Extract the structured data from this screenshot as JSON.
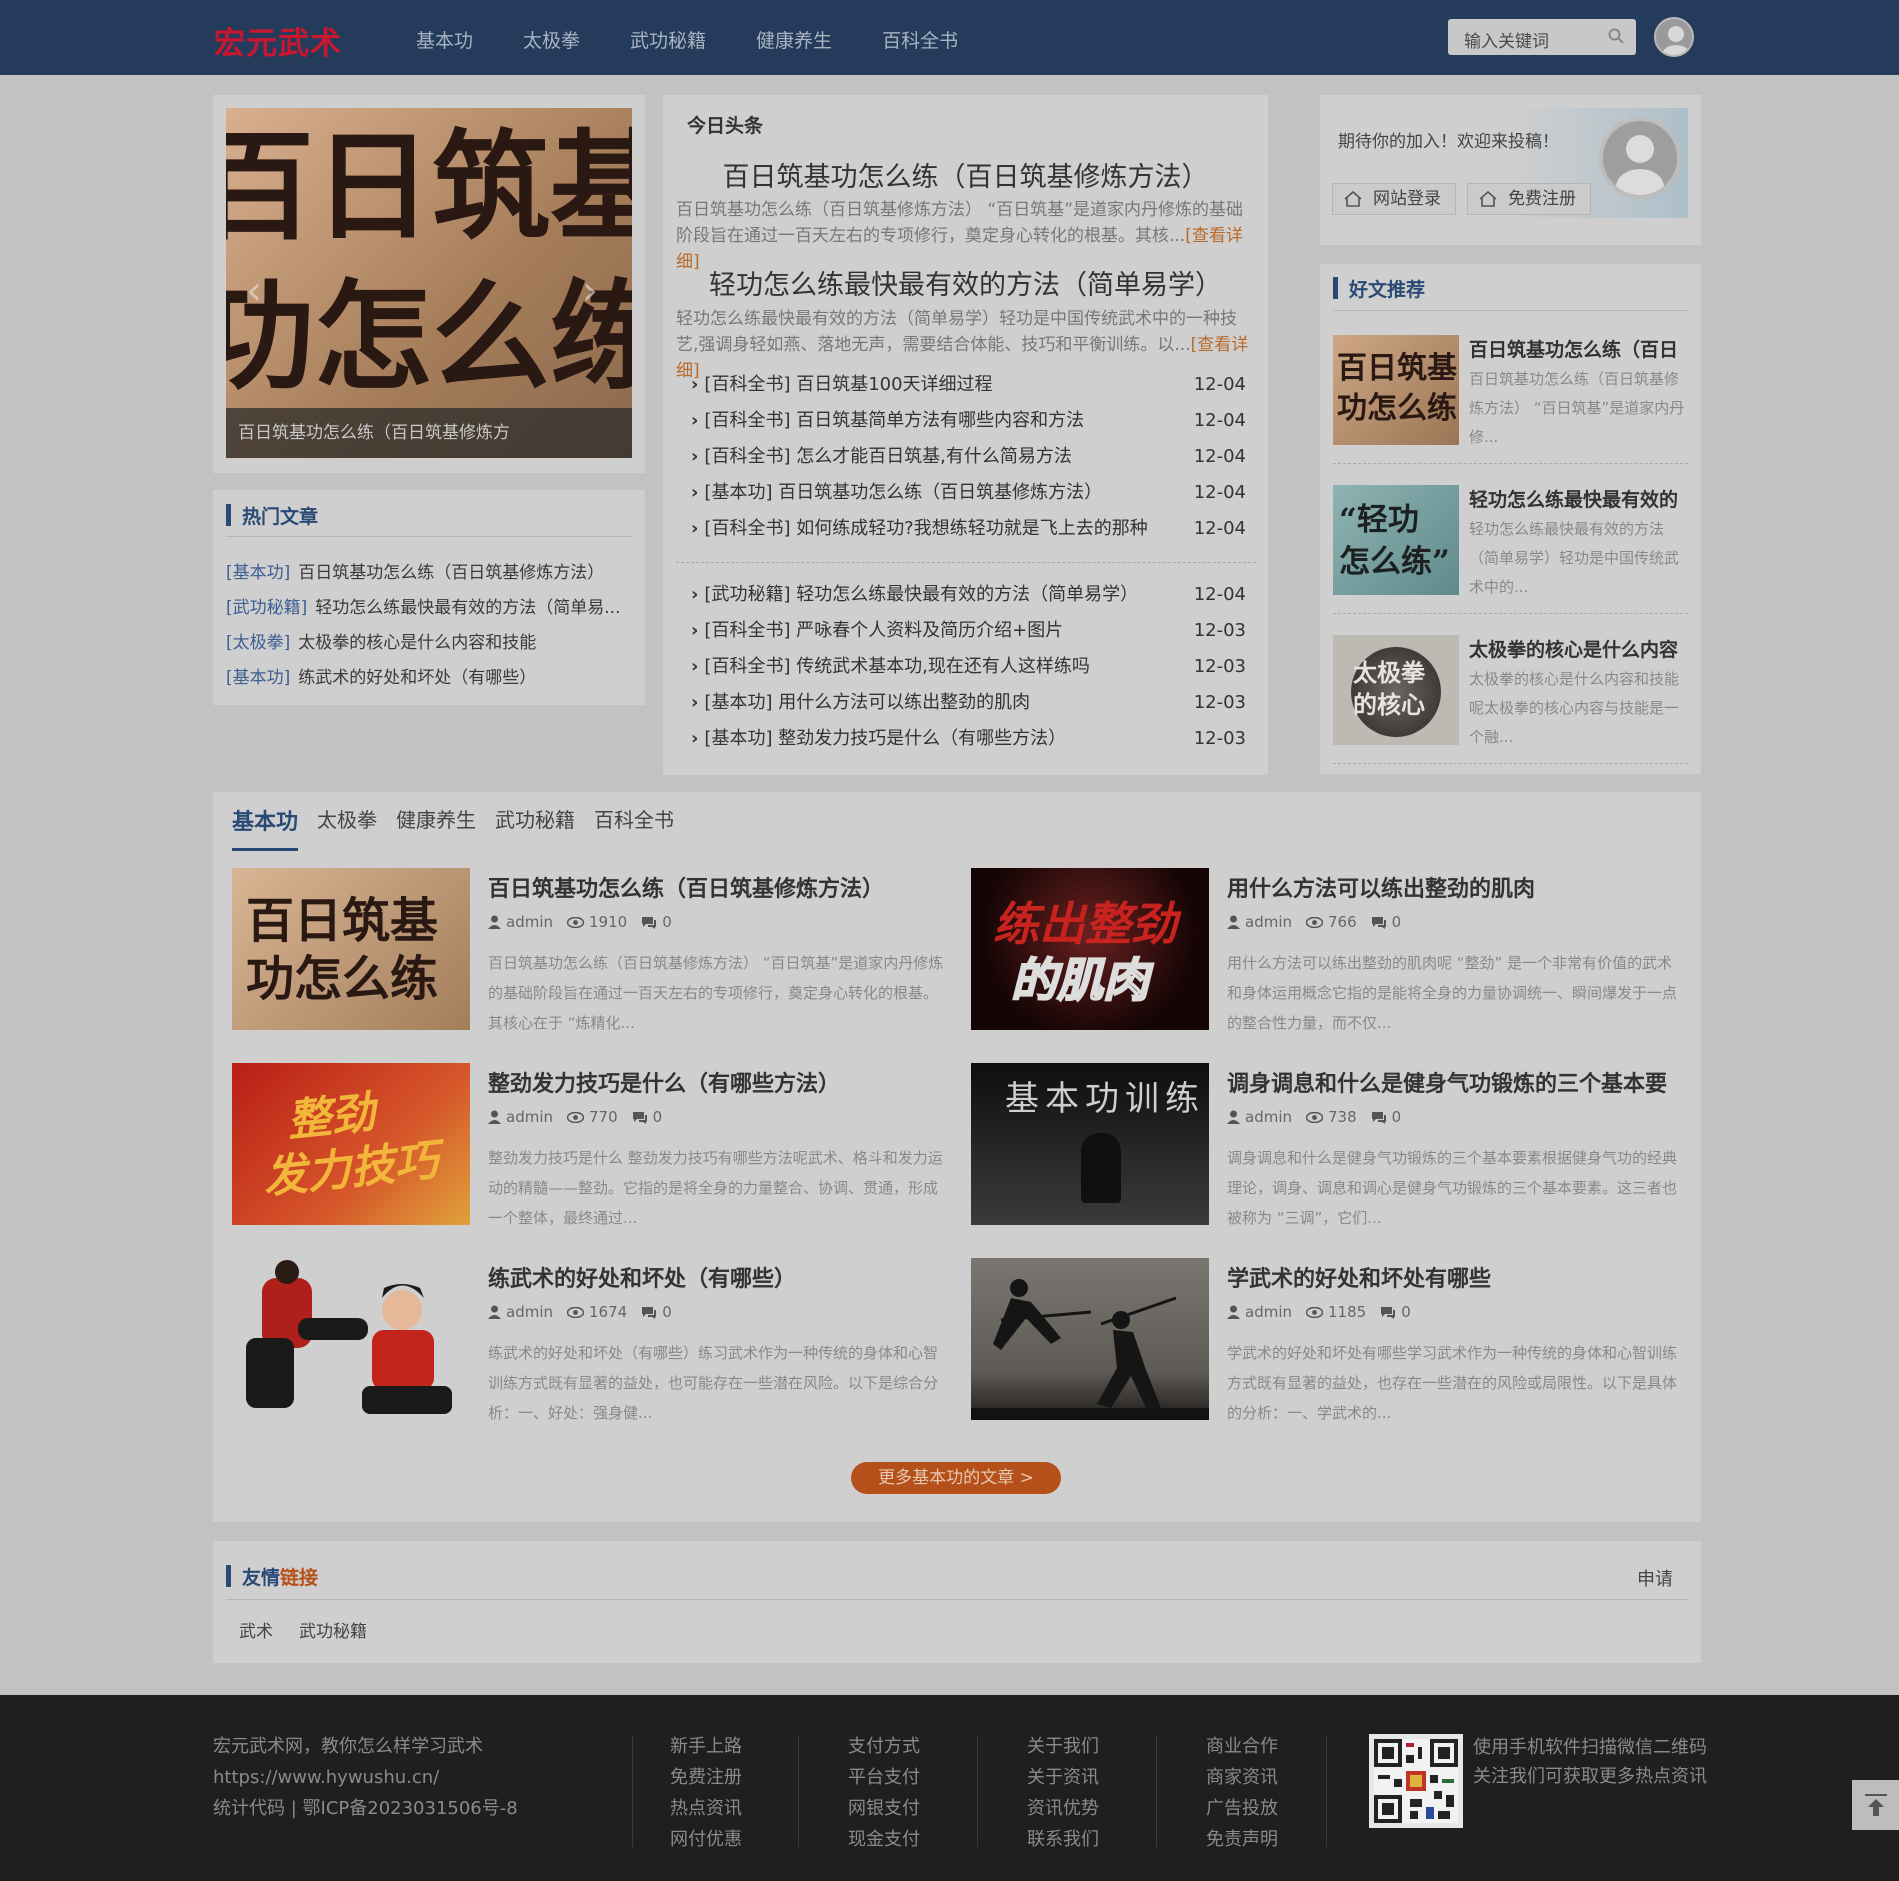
{
  "header": {
    "logo": "宏元武术",
    "nav": [
      "基本功",
      "太极拳",
      "武功秘籍",
      "健康养生",
      "百科全书"
    ],
    "search_placeholder": "输入关键词"
  },
  "slider": {
    "image_text_line1": "百日筑基",
    "image_text_line2": "功怎么练",
    "caption": "百日筑基功怎么练（百日筑基修炼方"
  },
  "hot": {
    "title": "热门文章",
    "items": [
      {
        "cat": "[基本功]",
        "title": "百日筑基功怎么练（百日筑基修炼方法）"
      },
      {
        "cat": "[武功秘籍]",
        "title": "轻功怎么练最快最有效的方法（简单易..."
      },
      {
        "cat": "[太极拳]",
        "title": "太极拳的核心是什么内容和技能"
      },
      {
        "cat": "[基本功]",
        "title": "练武术的好处和坏处（有哪些）"
      }
    ]
  },
  "headline": {
    "label": "今日头条",
    "h1": "百日筑基功怎么练（百日筑基修炼方法）",
    "d1": "百日筑基功怎么练（百日筑基修炼方法） “百日筑基”是道家内丹修炼的基础阶段旨在通过一百天左右的专项修行，奠定身心转化的根基。其核...",
    "h2": "轻功怎么练最快最有效的方法（简单易学）",
    "d2": "轻功怎么练最快最有效的方法（简单易学）轻功是中国传统武术中的一种技艺,强调身轻如燕、落地无声，需要结合体能、技巧和平衡训练。以...",
    "more": "[查看详细]",
    "list1": [
      {
        "t": "[百科全书] 百日筑基100天详细过程",
        "d": "12-04"
      },
      {
        "t": "[百科全书] 百日筑基简单方法有哪些内容和方法",
        "d": "12-04"
      },
      {
        "t": "[百科全书] 怎么才能百日筑基,有什么简易方法",
        "d": "12-04"
      },
      {
        "t": "[基本功] 百日筑基功怎么练（百日筑基修炼方法）",
        "d": "12-04"
      },
      {
        "t": "[百科全书] 如何练成轻功?我想练轻功就是飞上去的那种",
        "d": "12-04"
      }
    ],
    "list2": [
      {
        "t": "[武功秘籍] 轻功怎么练最快最有效的方法（简单易学）",
        "d": "12-04"
      },
      {
        "t": "[百科全书] 严咏春个人资料及简历介绍+图片",
        "d": "12-03"
      },
      {
        "t": "[百科全书] 传统武术基本功,现在还有人这样练吗",
        "d": "12-03"
      },
      {
        "t": "[基本功] 用什么方法可以练出整劲的肌肉",
        "d": "12-03"
      },
      {
        "t": "[基本功] 整劲发力技巧是什么（有哪些方法）",
        "d": "12-03"
      }
    ]
  },
  "login": {
    "welcome": "期待你的加入！欢迎来投稿！",
    "login_btn": "网站登录",
    "register_btn": "免费注册"
  },
  "recommend": {
    "title": "好文推荐",
    "items": [
      {
        "thumb_line1": "百日筑基",
        "thumb_line2": "功怎么练",
        "title": "百日筑基功怎么练（百日",
        "desc": "百日筑基功怎么练（百日筑基修炼方法） “百日筑基”是道家内丹修..."
      },
      {
        "thumb_line1": "“轻功",
        "thumb_line2": "怎么练”",
        "title": "轻功怎么练最快最有效的",
        "desc": "轻功怎么练最快最有效的方法（简单易学）轻功是中国传统武术中的..."
      },
      {
        "thumb_line1": "太极拳",
        "thumb_line2": "的核心",
        "title": "太极拳的核心是什么内容",
        "desc": "太极拳的核心是什么内容和技能呢太极拳的核心内容与技能是一个融..."
      }
    ]
  },
  "tabs": {
    "items": [
      "基本功",
      "太极拳",
      "健康养生",
      "武功秘籍",
      "百科全书"
    ],
    "more": "更多基本功的文章 >",
    "articles": [
      {
        "thumb_line1": "百日筑基",
        "thumb_line2": "功怎么练",
        "title": "百日筑基功怎么练（百日筑基修炼方法）",
        "author": "admin",
        "views": "1910",
        "comments": "0",
        "desc": "百日筑基功怎么练（百日筑基修炼方法） “百日筑基”是道家内丹修炼的基础阶段旨在通过一百天左右的专项修行，奠定身心转化的根基。其核心在于 “炼精化..."
      },
      {
        "thumb_line1": "练出整劲",
        "thumb_line2": "的肌肉",
        "title": "用什么方法可以练出整劲的肌肉",
        "author": "admin",
        "views": "766",
        "comments": "0",
        "desc": "用什么方法可以练出整劲的肌肉呢 “整劲” 是一个非常有价值的武术和身体运用概念它指的是能将全身的力量协调统一、瞬间爆发于一点的整合性力量，而不仅..."
      },
      {
        "thumb_line1": "整劲",
        "thumb_line2": "发力技巧",
        "title": "整劲发力技巧是什么（有哪些方法）",
        "author": "admin",
        "views": "770",
        "comments": "0",
        "desc": "整劲发力技巧是什么 整劲发力技巧有哪些方法呢武术、格斗和发力运动的精髓——整劲。它指的是将全身的力量整合、协调、贯通，形成一个整体，最终通过..."
      },
      {
        "thumb_line1": "基本功训练",
        "thumb_line2": "",
        "title": "调身调息和什么是健身气功锻炼的三个基本要",
        "author": "admin",
        "views": "738",
        "comments": "0",
        "desc": "调身调息和什么是健身气功锻炼的三个基本要素根据健身气功的经典理论，调身、调息和调心是健身气功锻炼的三个基本要素。这三者也被称为 “三调”，它们..."
      },
      {
        "thumb_line1": "",
        "thumb_line2": "",
        "title": "练武术的好处和坏处（有哪些）",
        "author": "admin",
        "views": "1674",
        "comments": "0",
        "desc": "练武术的好处和坏处（有哪些）练习武术作为一种传统的身体和心智训练方式既有显著的益处，也可能存在一些潜在风险。以下是综合分析：一、好处：强身健..."
      },
      {
        "thumb_line1": "",
        "thumb_line2": "",
        "title": "学武术的好处和坏处有哪些",
        "author": "admin",
        "views": "1185",
        "comments": "0",
        "desc": "学武术的好处和坏处有哪些学习武术作为一种传统的身体和心智训练方式既有显著的益处，也存在一些潜在的风险或局限性。以下是具体的分析：一、学武术的..."
      }
    ]
  },
  "links": {
    "title_a": "友情",
    "title_b": "链接",
    "apply": "申请",
    "items": [
      "武术",
      "武功秘籍"
    ]
  },
  "footer": {
    "info": [
      "宏元武术网，教你怎么样学习武术",
      "https://www.hywushu.cn/",
      "统计代码 | 鄂ICP备2023031506号-8"
    ],
    "cols": [
      [
        "新手上路",
        "免费注册",
        "热点资讯",
        "网付优惠"
      ],
      [
        "支付方式",
        "平台支付",
        "网银支付",
        "现金支付"
      ],
      [
        "关于我们",
        "关于资讯",
        "资讯优势",
        "联系我们"
      ],
      [
        "商业合作",
        "商家资讯",
        "广告投放",
        "免责声明"
      ]
    ],
    "qr_text": [
      "使用手机软件扫描微信二维码",
      "关注我们可获取更多热点资讯"
    ]
  }
}
